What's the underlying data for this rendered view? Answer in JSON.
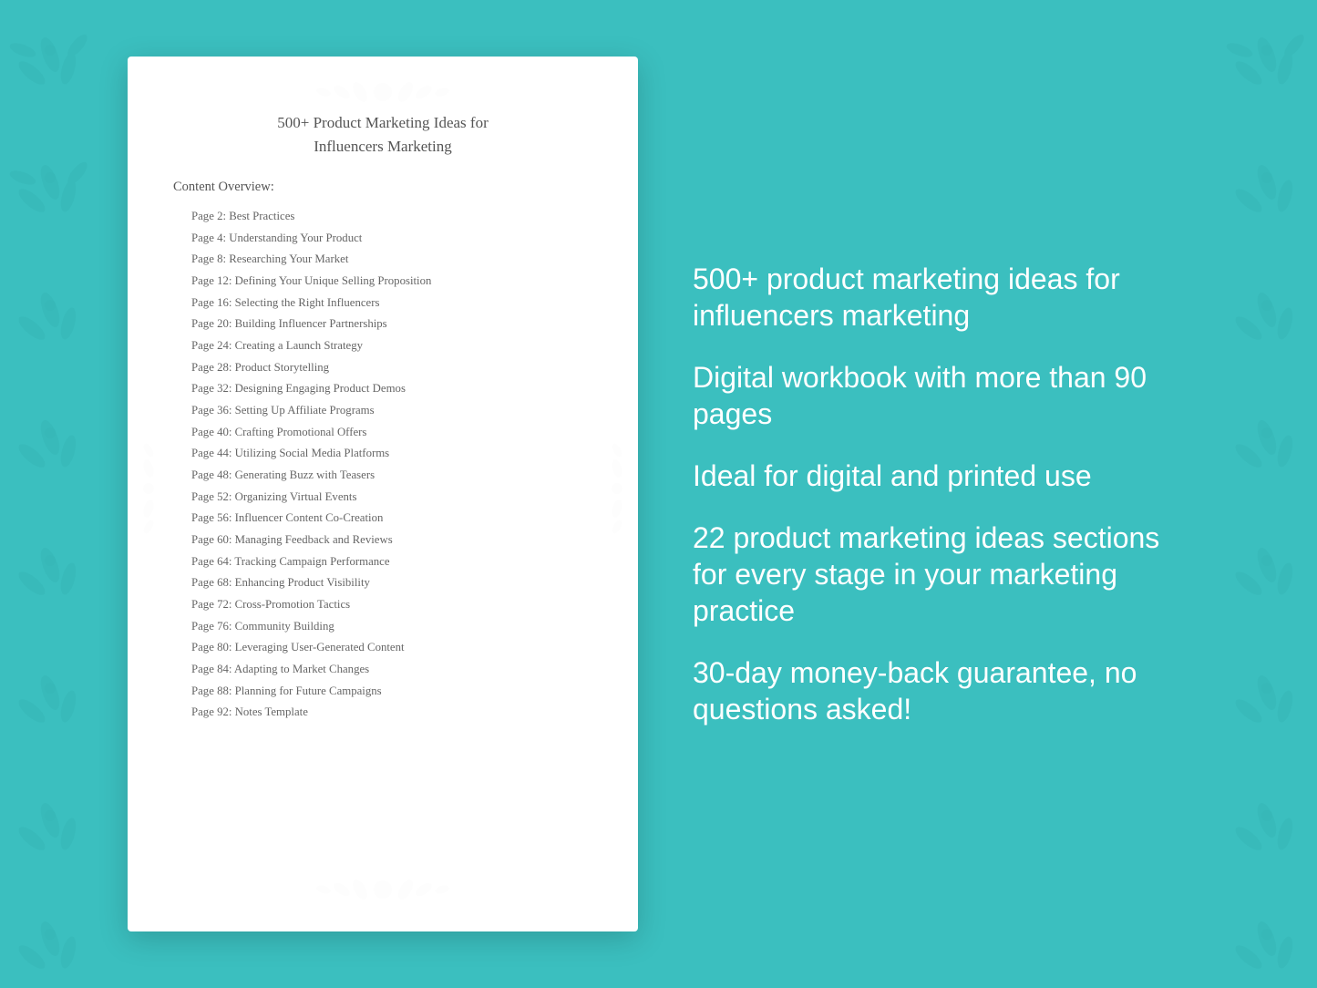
{
  "background": {
    "color": "#3bbfbf"
  },
  "document": {
    "title_line1": "500+ Product Marketing Ideas for",
    "title_line2": "Influencers Marketing",
    "content_overview_label": "Content Overview:",
    "toc_items": [
      "Page  2:  Best Practices",
      "Page  4:  Understanding Your Product",
      "Page  8:  Researching Your Market",
      "Page 12:  Defining Your Unique Selling Proposition",
      "Page 16:  Selecting the Right Influencers",
      "Page 20:  Building Influencer Partnerships",
      "Page 24:  Creating a Launch Strategy",
      "Page 28:  Product Storytelling",
      "Page 32:  Designing Engaging Product Demos",
      "Page 36:  Setting Up Affiliate Programs",
      "Page 40:  Crafting Promotional Offers",
      "Page 44:  Utilizing Social Media Platforms",
      "Page 48:  Generating Buzz with Teasers",
      "Page 52:  Organizing Virtual Events",
      "Page 56:  Influencer Content Co-Creation",
      "Page 60:  Managing Feedback and Reviews",
      "Page 64:  Tracking Campaign Performance",
      "Page 68:  Enhancing Product Visibility",
      "Page 72:  Cross-Promotion Tactics",
      "Page 76:  Community Building",
      "Page 80:  Leveraging User-Generated Content",
      "Page 84:  Adapting to Market Changes",
      "Page 88:  Planning for Future Campaigns",
      "Page 92:  Notes Template"
    ]
  },
  "features": [
    "500+ product marketing ideas for influencers marketing",
    "Digital workbook with more than 90 pages",
    "Ideal for digital and printed use",
    "22 product marketing ideas sections for every stage in your marketing practice",
    "30-day money-back guarantee, no questions asked!"
  ]
}
